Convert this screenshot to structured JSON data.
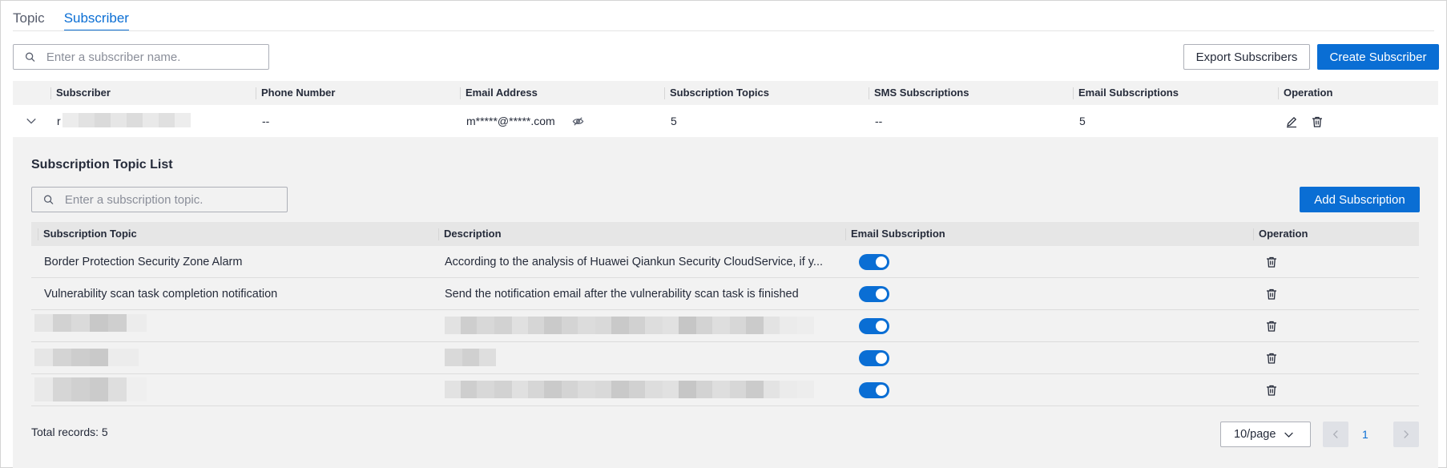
{
  "tabs": [
    {
      "label": "Topic",
      "active": false
    },
    {
      "label": "Subscriber",
      "active": true
    }
  ],
  "search": {
    "placeholder": "Enter a subscriber name."
  },
  "buttons": {
    "export": "Export Subscribers",
    "create": "Create Subscriber"
  },
  "table": {
    "headers": {
      "subscriber": "Subscriber",
      "phone": "Phone Number",
      "email": "Email Address",
      "topics": "Subscription Topics",
      "sms": "SMS Subscriptions",
      "email_subs": "Email Subscriptions",
      "operation": "Operation"
    },
    "row": {
      "subscriber": "r",
      "phone": "--",
      "email": "m*****@*****.com",
      "topics": "5",
      "sms": "--",
      "email_subs": "5"
    }
  },
  "panel": {
    "title": "Subscription Topic List",
    "search_placeholder": "Enter a subscription topic.",
    "add_button": "Add Subscription",
    "headers": {
      "topic": "Subscription Topic",
      "description": "Description",
      "email_subscription": "Email Subscription",
      "operation": "Operation"
    },
    "rows": [
      {
        "topic": "Border Protection Security Zone Alarm",
        "description": "According to the analysis of Huawei Qiankun Security CloudService, if y...",
        "email_enabled": true
      },
      {
        "topic": "Vulnerability scan task completion notification",
        "description": "Send the notification email after the vulnerability scan task is finished",
        "email_enabled": true
      },
      {
        "topic": "",
        "description": "",
        "email_enabled": true
      },
      {
        "topic": "",
        "description": "",
        "email_enabled": true
      },
      {
        "topic": "",
        "description": "",
        "email_enabled": true
      }
    ],
    "total_records": "Total records: 5",
    "page_size": "10/page",
    "current_page": "1"
  },
  "colors": {
    "accent": "#0a6ed4",
    "header_bg": "#f2f2f2",
    "panel_bg": "#f2f2f2"
  },
  "icons": [
    "search-icon",
    "chevron-down-icon",
    "eye-slash-icon",
    "edit-icon",
    "trash-icon",
    "chevron-left-icon",
    "chevron-right-icon"
  ]
}
